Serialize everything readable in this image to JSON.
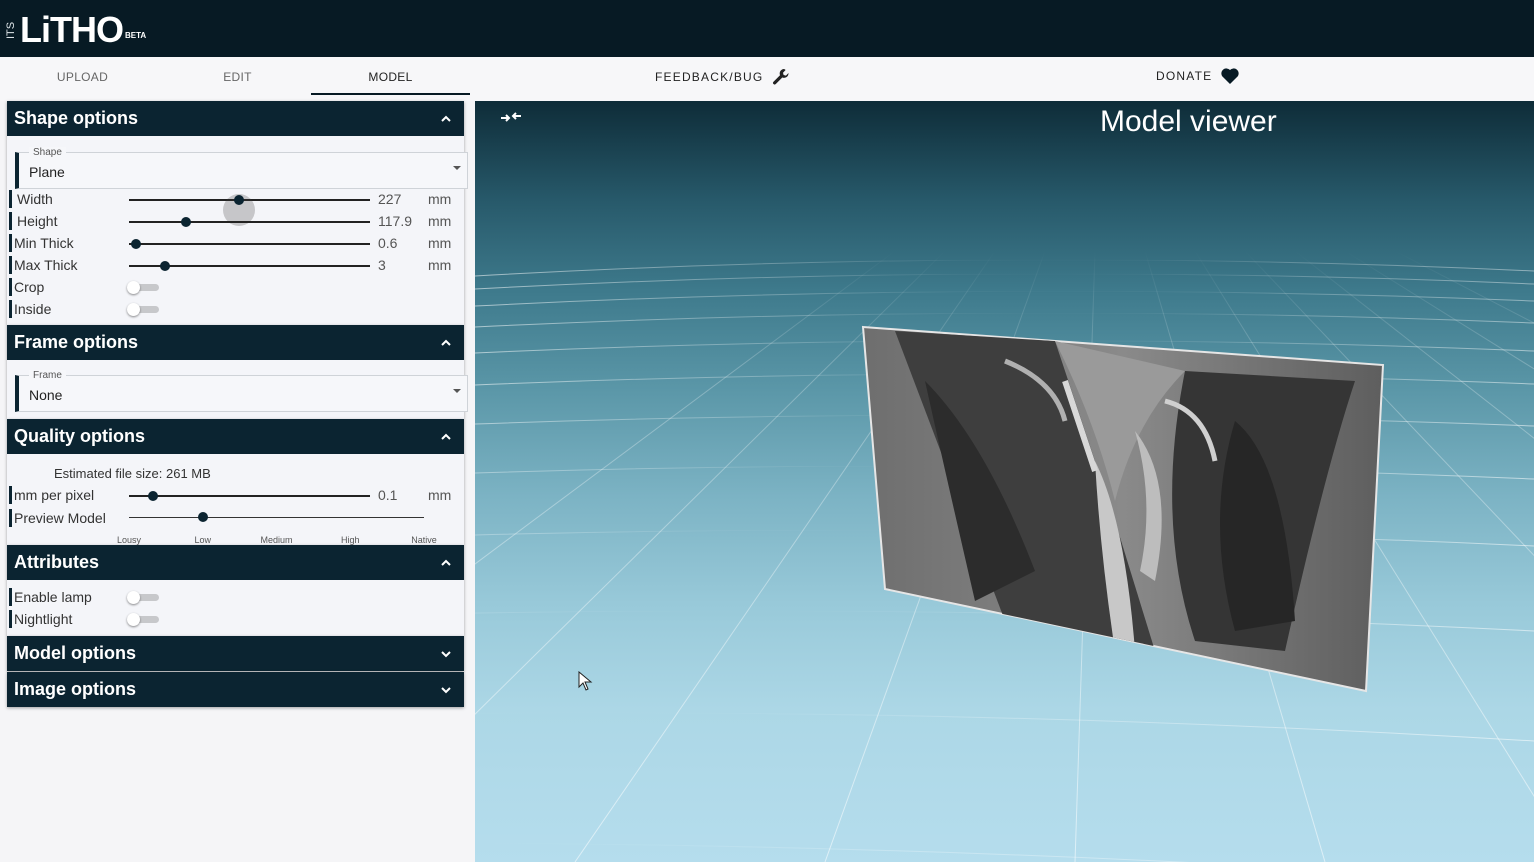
{
  "app": {
    "logo_prefix": "ITS",
    "logo_text": "LiTHO",
    "logo_badge": "BETA"
  },
  "tabs": [
    {
      "label": "UPLOAD"
    },
    {
      "label": "EDIT"
    },
    {
      "label": "MODEL"
    }
  ],
  "nav": {
    "feedback": "FEEDBACK/BUG",
    "donate": "DONATE"
  },
  "shape_options": {
    "title": "Shape options",
    "shape_field": {
      "label": "Shape",
      "value": "Plane"
    },
    "sliders": [
      {
        "name": "Width",
        "value": "227",
        "unit": "mm",
        "fraction": 0.455
      },
      {
        "name": "Height",
        "value": "117.9",
        "unit": "mm",
        "fraction": 0.235
      },
      {
        "name": "Min Thick",
        "value": "0.6",
        "unit": "mm",
        "fraction": 0.03
      },
      {
        "name": "Max Thick",
        "value": "3",
        "unit": "mm",
        "fraction": 0.15
      }
    ],
    "toggles": [
      {
        "name": "Crop",
        "on": false
      },
      {
        "name": "Inside",
        "on": false
      }
    ]
  },
  "frame_options": {
    "title": "Frame options",
    "frame_field": {
      "label": "Frame",
      "value": "None"
    }
  },
  "quality_options": {
    "title": "Quality options",
    "estimated_size": "Estimated file size: 261 MB",
    "mm_per_pixel": {
      "name": "mm per pixel",
      "value": "0.1",
      "unit": "mm",
      "fraction": 0.1
    },
    "preview_model": {
      "name": "Preview Model",
      "selected": "Low",
      "levels": [
        "Lousy",
        "Low",
        "Medium",
        "High",
        "Native"
      ]
    }
  },
  "attributes": {
    "title": "Attributes",
    "toggles": [
      {
        "name": "Enable lamp",
        "on": false
      },
      {
        "name": "Nightlight",
        "on": false
      }
    ]
  },
  "model_options": {
    "title": "Model options"
  },
  "image_options": {
    "title": "Image options"
  },
  "viewer": {
    "title": "Model viewer"
  }
}
